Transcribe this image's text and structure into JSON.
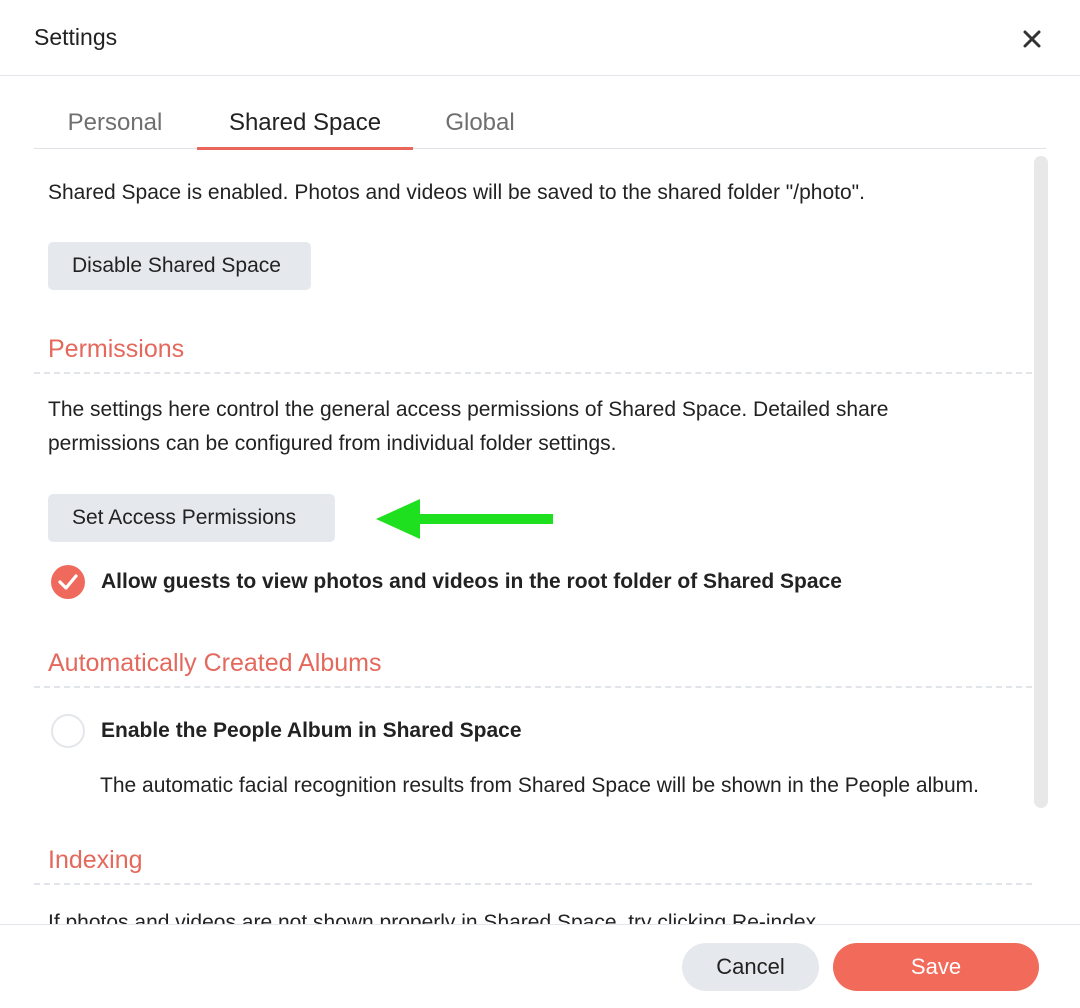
{
  "window": {
    "title": "Settings"
  },
  "tabs": [
    {
      "label": "Personal",
      "active": false
    },
    {
      "label": "Shared Space",
      "active": true
    },
    {
      "label": "Global",
      "active": false
    }
  ],
  "shared": {
    "status_text": "Shared Space is enabled. Photos and videos will be saved to the shared folder \"/photo\".",
    "disable_button": "Disable Shared Space"
  },
  "permissions": {
    "title": "Permissions",
    "desc_line1": "The settings here control the general access permissions of Shared Space. Detailed share",
    "desc_line2": "permissions can be configured from individual folder settings.",
    "set_button": "Set Access Permissions",
    "guest_label": "Allow guests to view photos and videos in the root folder of Shared Space",
    "guest_checked": true
  },
  "albums": {
    "title": "Automatically Created Albums",
    "people_label": "Enable the People Album in Shared Space",
    "people_checked": false,
    "people_desc": "The automatic facial recognition results from Shared Space will be shown in the People album."
  },
  "indexing": {
    "title": "Indexing",
    "desc": "If photos and videos are not shown properly in Shared Space, try clicking Re-index."
  },
  "footer": {
    "cancel": "Cancel",
    "save": "Save"
  },
  "colors": {
    "accent": "#f26a5a",
    "section_title": "#e4685c",
    "arrow": "#1fe01f",
    "button_gray": "#e5e8ec"
  },
  "icons": {
    "close": "close-icon",
    "check": "check-icon",
    "arrow": "arrow-left-icon"
  }
}
